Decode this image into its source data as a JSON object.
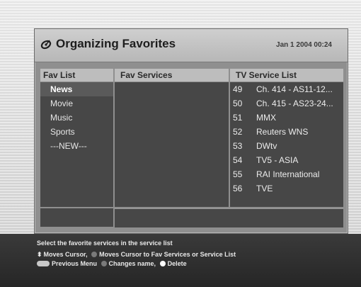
{
  "header": {
    "title": "Organizing Favorites",
    "datetime": "Jan 1 2004 00:24"
  },
  "columns": {
    "fav_list": "Fav List",
    "fav_services": "Fav Services",
    "service_list": "TV Service List"
  },
  "fav_list": {
    "items": [
      "News",
      "Movie",
      "Music",
      "Sports",
      "---NEW---"
    ],
    "selected": "News"
  },
  "fav_services": [],
  "service_list": [
    {
      "num": "49",
      "name": "Ch. 414 - AS11-12..."
    },
    {
      "num": "50",
      "name": "Ch. 415 - AS23-24..."
    },
    {
      "num": "51",
      "name": "MMX"
    },
    {
      "num": "52",
      "name": "Reuters WNS"
    },
    {
      "num": "53",
      "name": "DWtv"
    },
    {
      "num": "54",
      "name": "TV5 - ASIA"
    },
    {
      "num": "55",
      "name": "RAI International"
    },
    {
      "num": "56",
      "name": "TVE"
    }
  ],
  "help": {
    "title": "Select the favorite services in the service list",
    "move_cursor": "Moves Cursor,",
    "move_to_lists": "Moves Cursor to Fav Services or Service List",
    "previous_menu": "Previous Menu",
    "change_name": "Changes name,",
    "delete": "Delete"
  },
  "icons": {
    "title": "satellite-icon",
    "updown": "up-down-arrow-icon",
    "menu_key": "menu-key-icon"
  }
}
